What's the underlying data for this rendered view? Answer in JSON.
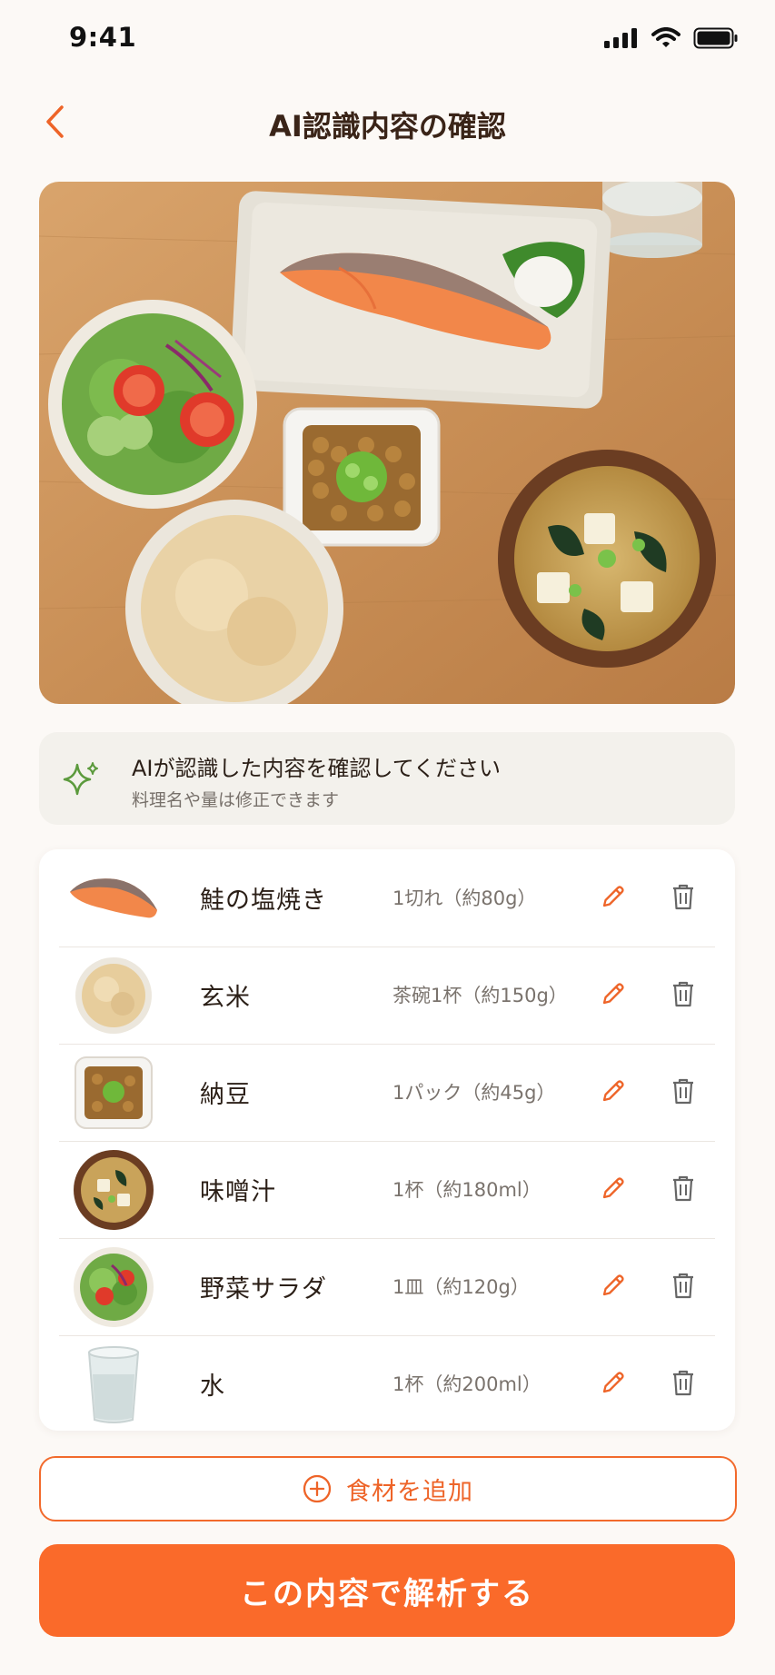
{
  "status_bar": {
    "time": "9:41"
  },
  "header": {
    "title": "AI認識内容の確認"
  },
  "notice": {
    "title": "AIが認識した内容を確認してください",
    "subtitle": "料理名や量は修正できます",
    "icon": "sparkle-icon"
  },
  "foods": [
    {
      "name": "鮭の塩焼き",
      "amount": "1切れ（約80g）",
      "icon": "salmon-thumbnail"
    },
    {
      "name": "玄米",
      "amount": "茶碗1杯（約150g）",
      "icon": "brown-rice-thumbnail"
    },
    {
      "name": "納豆",
      "amount": "1パック（約45g）",
      "icon": "natto-thumbnail"
    },
    {
      "name": "味噌汁",
      "amount": "1杯（約180ml）",
      "icon": "miso-soup-thumbnail"
    },
    {
      "name": "野菜サラダ",
      "amount": "1皿（約120g）",
      "icon": "salad-thumbnail"
    },
    {
      "name": "水",
      "amount": "1杯（約200ml）",
      "icon": "water-glass-thumbnail"
    }
  ],
  "actions": {
    "add_ingredient": "食材を追加",
    "analyze": "この内容で解析する"
  },
  "colors": {
    "accent": "#fa6a2a",
    "background": "#fcf9f6",
    "title_text": "#3a2418",
    "notice_icon": "#5b9a3c"
  }
}
